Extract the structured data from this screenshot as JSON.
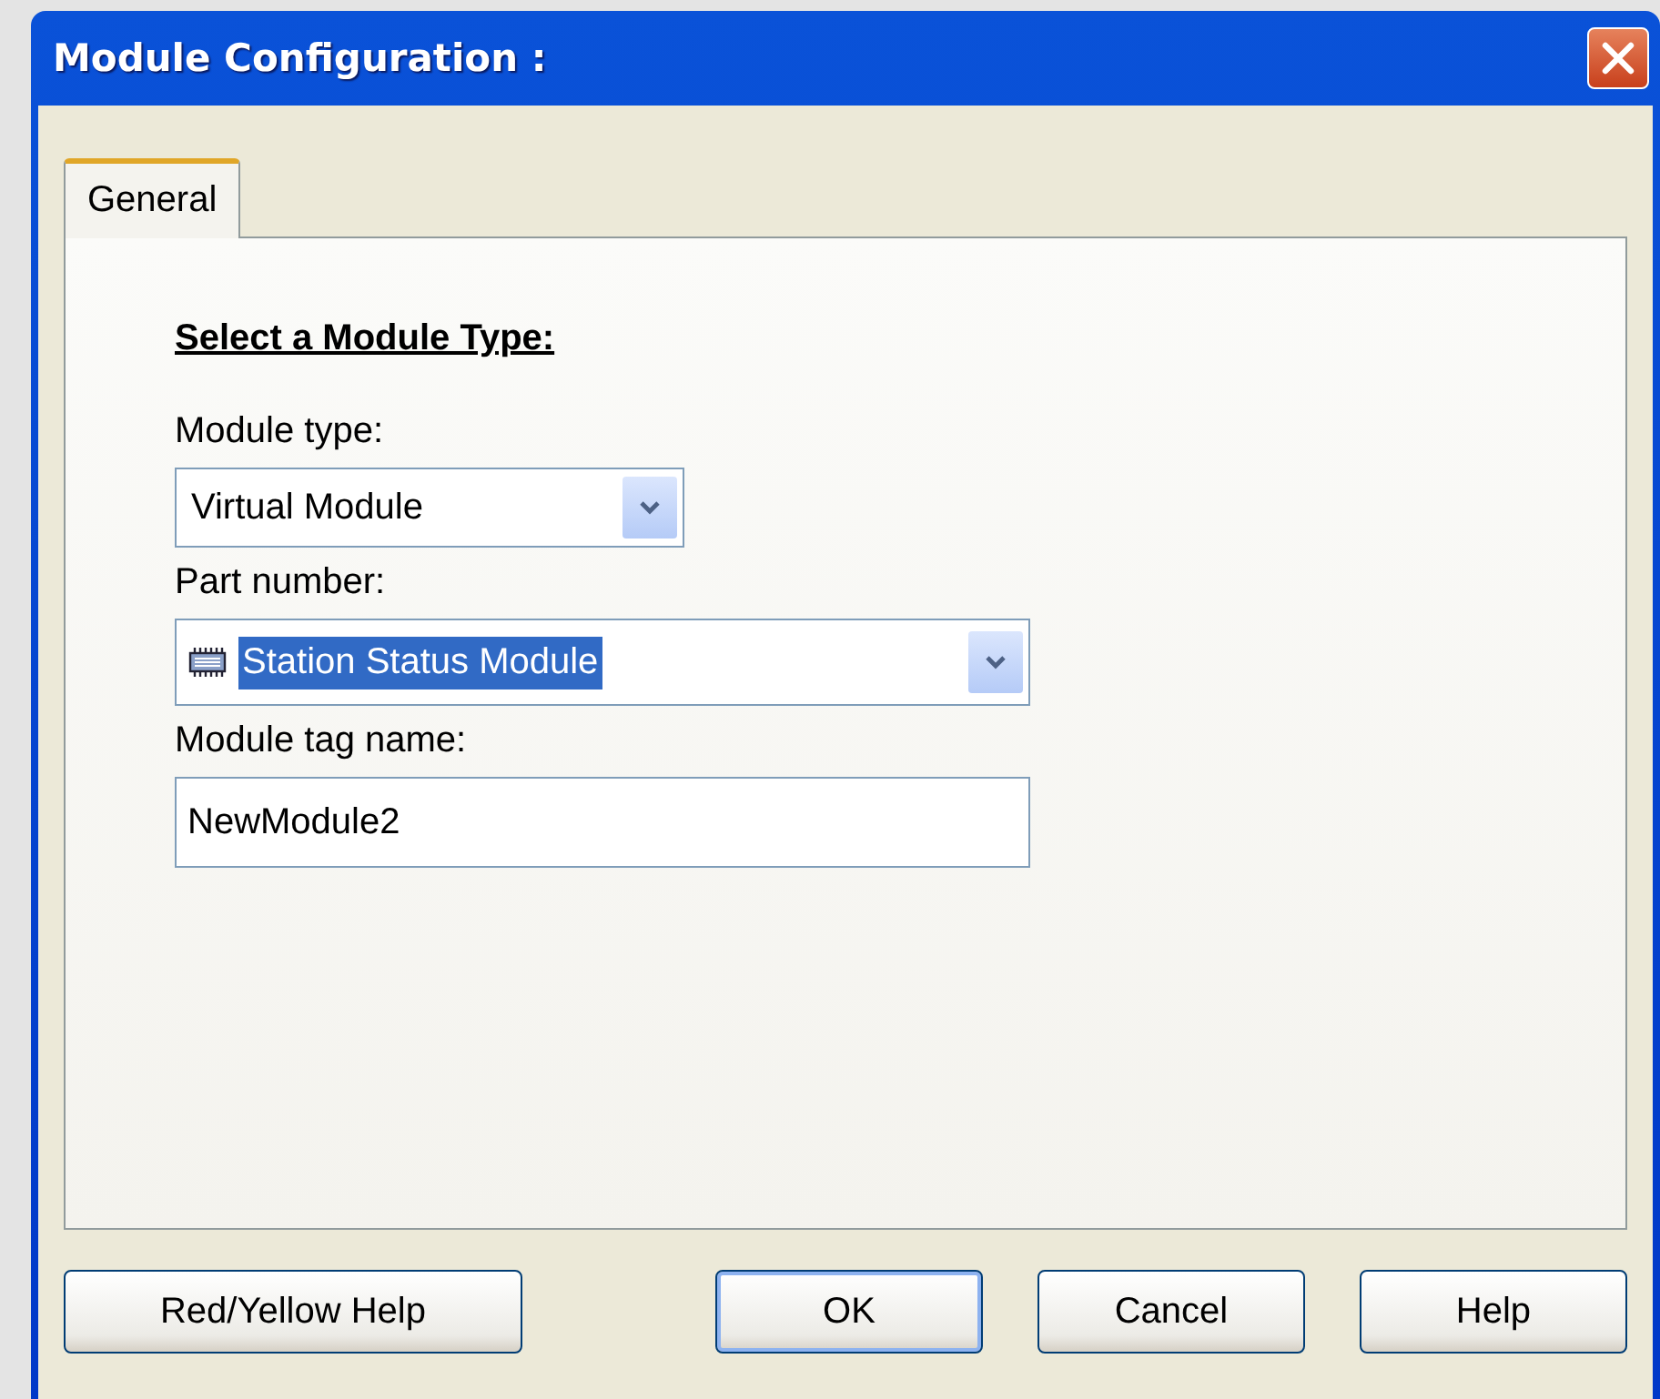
{
  "window": {
    "title": "Module Configuration :"
  },
  "tabs": [
    {
      "label": "General",
      "selected": true
    }
  ],
  "heading": "Select a Module Type:",
  "fields": [
    {
      "kind": "dropdown",
      "label": "Module type:",
      "value": "Virtual Module",
      "highlighted": false,
      "icon": false
    },
    {
      "kind": "dropdown",
      "label": "Part number:",
      "value": "Station Status Module",
      "highlighted": true,
      "icon": true
    },
    {
      "kind": "text",
      "label": "Module tag name:",
      "value": "NewModule2"
    }
  ],
  "buttons": [
    {
      "label": "Red/Yellow Help",
      "default": false
    },
    {
      "label": "OK",
      "default": true
    },
    {
      "label": "Cancel",
      "default": false
    },
    {
      "label": "Help",
      "default": false
    }
  ]
}
